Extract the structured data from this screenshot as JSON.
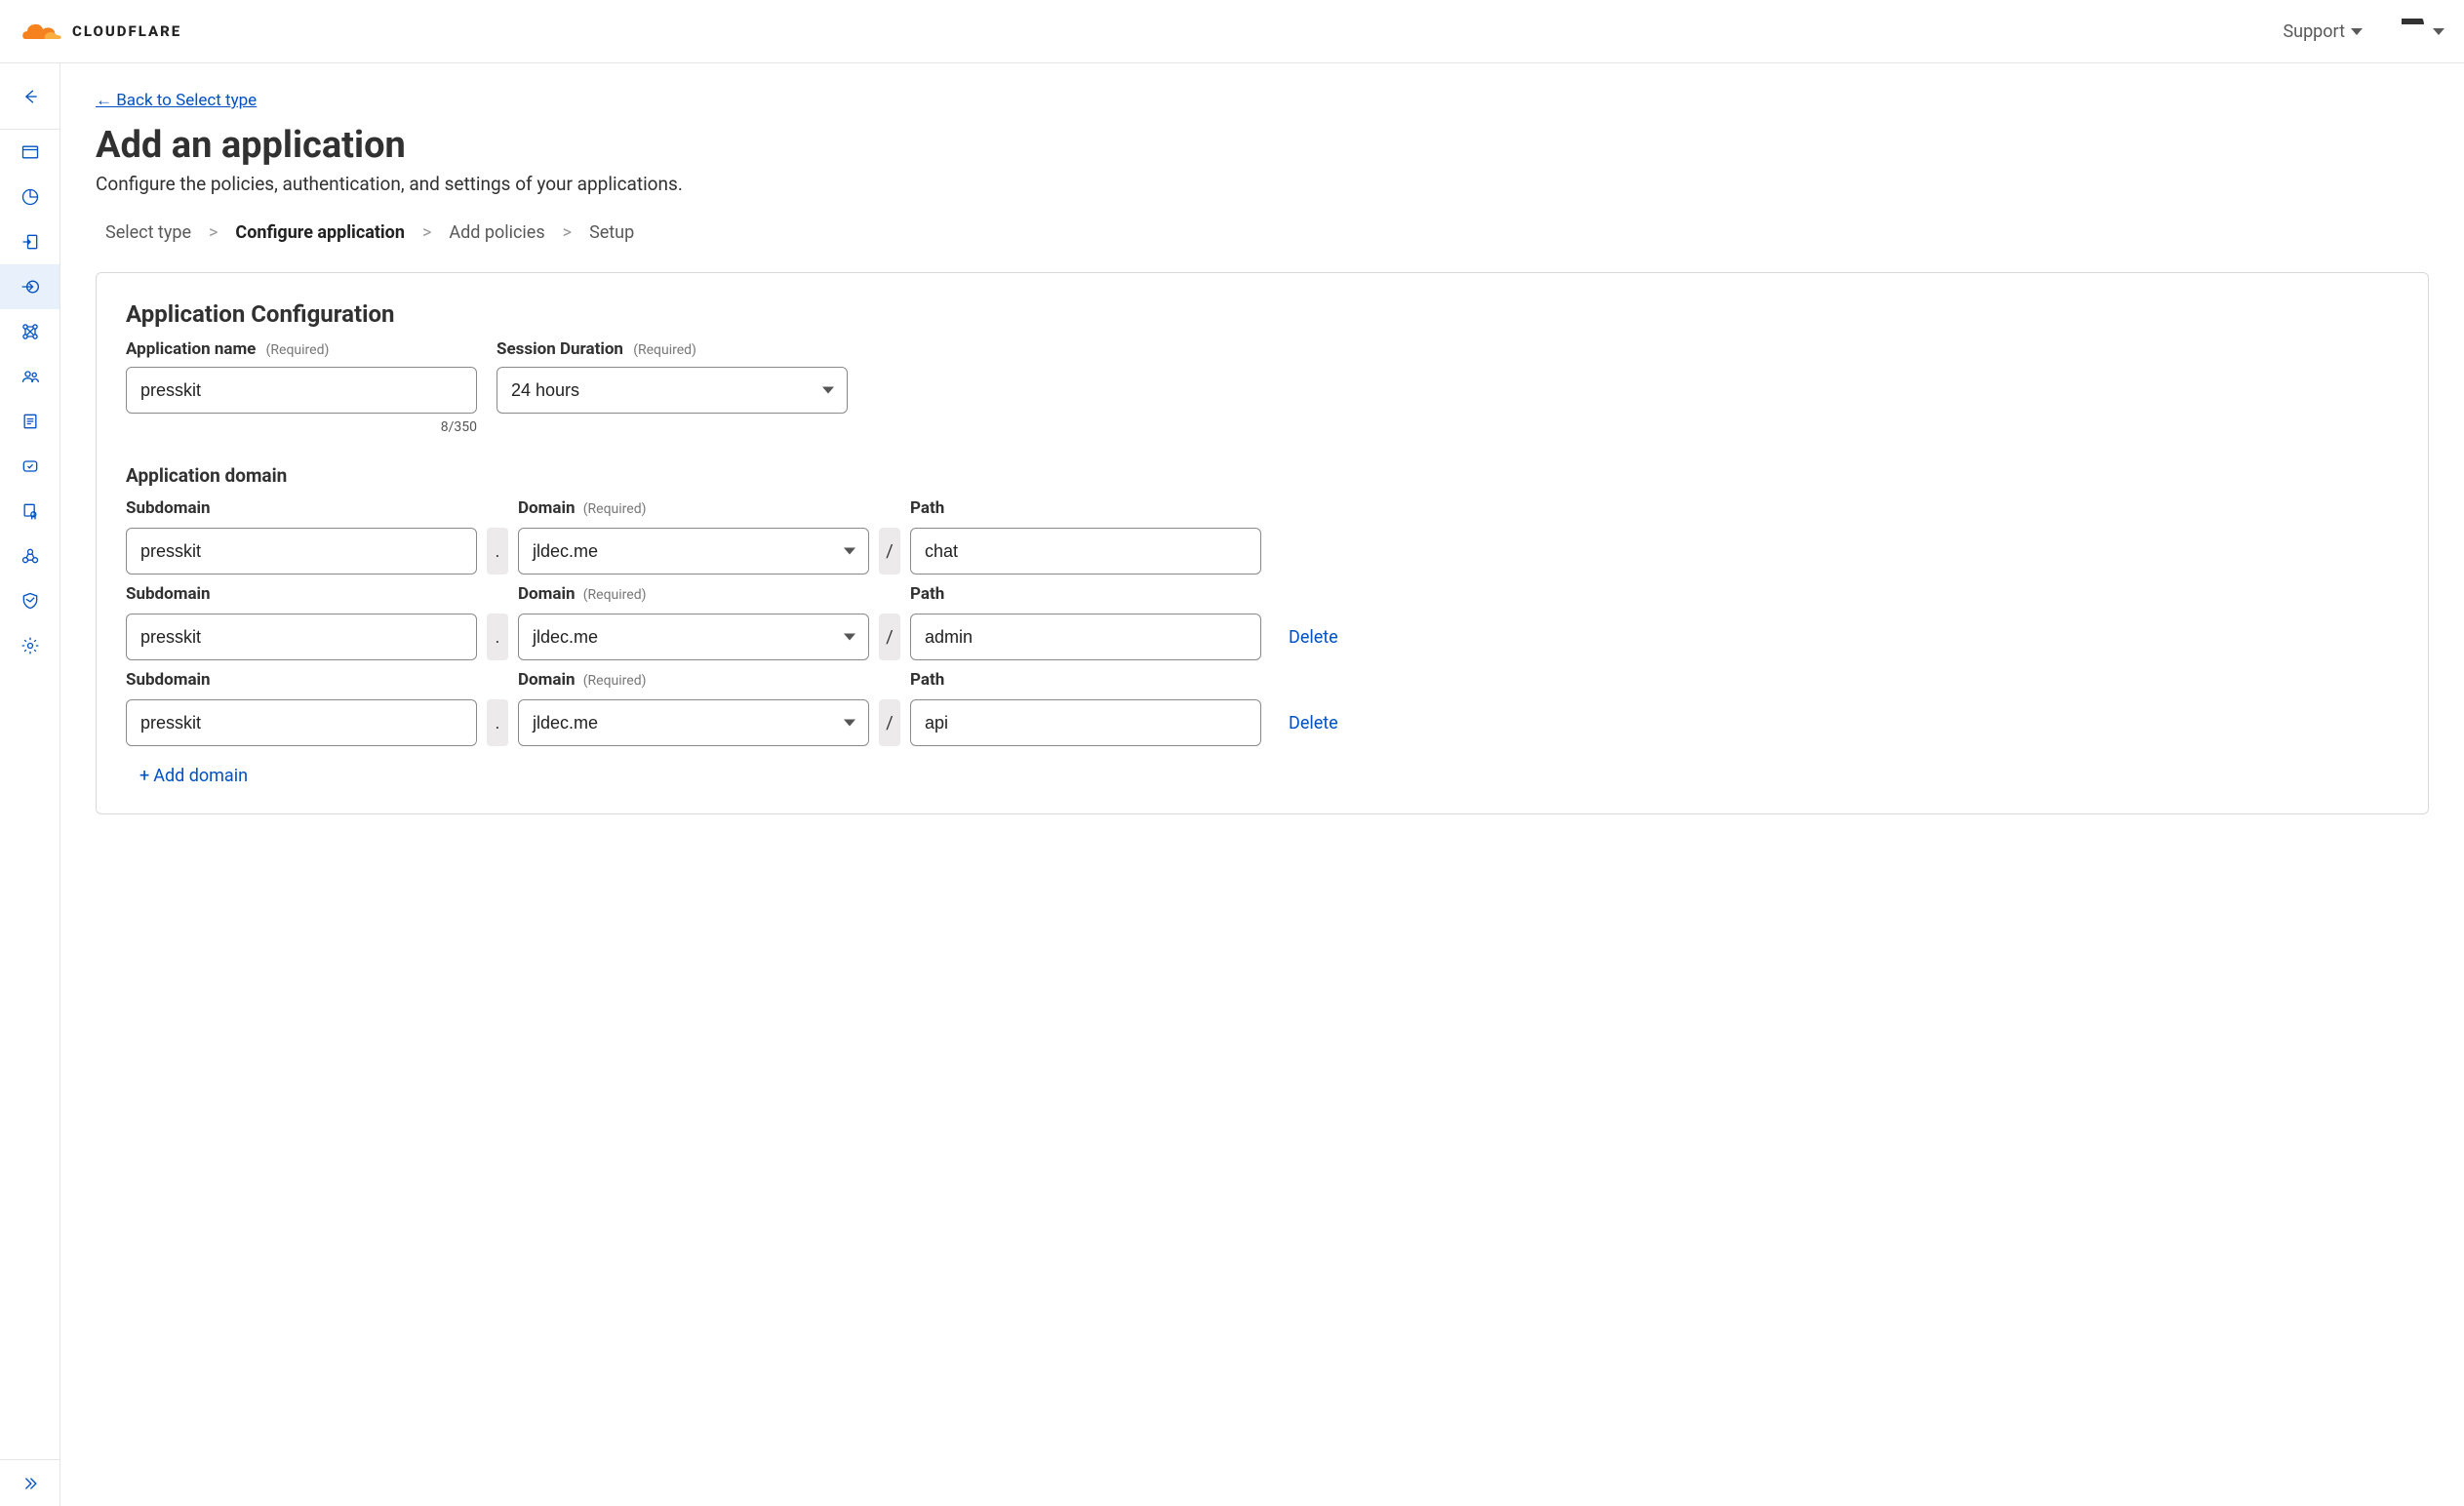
{
  "header": {
    "brand": "CLOUDFLARE",
    "support_label": "Support"
  },
  "sidebar": {
    "items": [
      {
        "name": "back-icon"
      },
      {
        "name": "browser-icon"
      },
      {
        "name": "analytics-icon"
      },
      {
        "name": "access-out-icon"
      },
      {
        "name": "access-in-icon",
        "active": true
      },
      {
        "name": "network-icon"
      },
      {
        "name": "team-icon"
      },
      {
        "name": "list-icon"
      },
      {
        "name": "updates-icon"
      },
      {
        "name": "cert-icon"
      },
      {
        "name": "tunnel-icon"
      },
      {
        "name": "shield-icon"
      },
      {
        "name": "settings-icon"
      }
    ]
  },
  "page": {
    "back_link": "← Back to Select type",
    "title": "Add an application",
    "subtitle": "Configure the policies, authentication, and settings of your applications."
  },
  "stepper": {
    "step1": "Select type",
    "step2": "Configure application",
    "step3": "Add policies",
    "step4": "Setup",
    "sep": ">"
  },
  "form": {
    "section_title": "Application Configuration",
    "app_name": {
      "label": "Application name",
      "required": "(Required)",
      "value": "presskit",
      "counter": "8/350"
    },
    "session": {
      "label": "Session Duration",
      "required": "(Required)",
      "value": "24 hours"
    },
    "domain_section_label": "Application domain",
    "col_labels": {
      "subdomain": "Subdomain",
      "domain": "Domain",
      "domain_req": "(Required)",
      "path": "Path"
    },
    "separators": {
      "dot": ".",
      "slash": "/"
    },
    "rows": [
      {
        "subdomain": "presskit",
        "domain": "jldec.me",
        "path": "chat",
        "deletable": false
      },
      {
        "subdomain": "presskit",
        "domain": "jldec.me",
        "path": "admin",
        "deletable": true
      },
      {
        "subdomain": "presskit",
        "domain": "jldec.me",
        "path": "api",
        "deletable": true
      }
    ],
    "delete_label": "Delete",
    "add_domain_label": "Add domain"
  }
}
